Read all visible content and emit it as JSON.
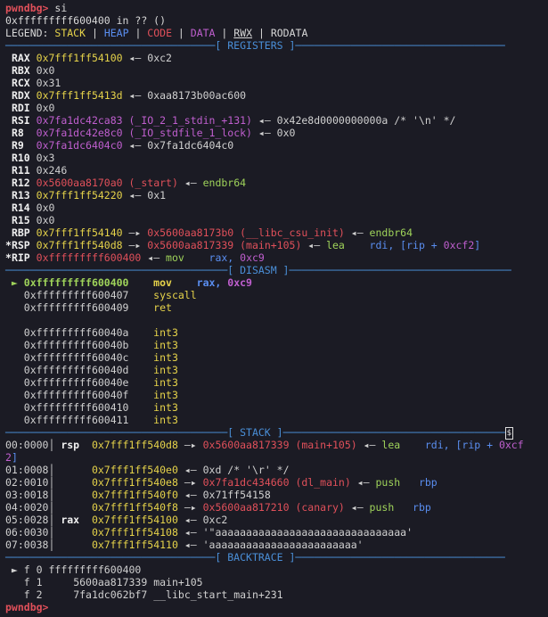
{
  "prompt": {
    "label": "pwndbg>",
    "command": "si"
  },
  "location": "0xfffffffff600400 in ?? ()",
  "legend": {
    "prefix": "LEGEND:",
    "items": [
      "STACK",
      "HEAP",
      "CODE",
      "DATA",
      "RWX",
      "RODATA"
    ],
    "sep": " | "
  },
  "headers": {
    "registers": "[ REGISTERS ]",
    "disasm": "[ DISASM ]",
    "stack": "[ STACK ]",
    "backtrace": "[ BACKTRACE ]"
  },
  "registers": [
    {
      "name": "RAX",
      "prefix": " ",
      "val": "0x7fff1ff54100",
      "val_color": "yel",
      "rest": [
        {
          "t": " ◂— ",
          "c": "gry"
        },
        {
          "t": "0xc2",
          "c": "gry"
        }
      ]
    },
    {
      "name": "RBX",
      "prefix": " ",
      "val": "0x0",
      "val_color": "gry",
      "rest": []
    },
    {
      "name": "RCX",
      "prefix": " ",
      "val": "0x31",
      "val_color": "gry",
      "rest": []
    },
    {
      "name": "RDX",
      "prefix": " ",
      "val": "0x7fff1ff5413d",
      "val_color": "yel",
      "rest": [
        {
          "t": " ◂— ",
          "c": "gry"
        },
        {
          "t": "0xaa8173b00ac600",
          "c": "gry"
        }
      ]
    },
    {
      "name": "RDI",
      "prefix": " ",
      "val": "0x0",
      "val_color": "gry",
      "rest": []
    },
    {
      "name": "RSI",
      "prefix": " ",
      "val": "0x7fa1dc42ca83 (_IO_2_1_stdin_+131)",
      "val_color": "mag",
      "rest": [
        {
          "t": " ◂— ",
          "c": "gry"
        },
        {
          "t": "0x42e8d0000000000a /* '\\n' */",
          "c": "gry"
        }
      ]
    },
    {
      "name": "R8",
      "prefix": " ",
      "val": "0x7fa1dc42e8c0 (_IO_stdfile_1_lock)",
      "val_color": "mag",
      "rest": [
        {
          "t": " ◂— ",
          "c": "gry"
        },
        {
          "t": "0x0",
          "c": "gry"
        }
      ]
    },
    {
      "name": "R9",
      "prefix": " ",
      "val": "0x7fa1dc6404c0",
      "val_color": "mag",
      "rest": [
        {
          "t": " ◂— ",
          "c": "gry"
        },
        {
          "t": "0x7fa1dc6404c0",
          "c": "gry"
        }
      ]
    },
    {
      "name": "R10",
      "prefix": " ",
      "val": "0x3",
      "val_color": "gry",
      "rest": []
    },
    {
      "name": "R11",
      "prefix": " ",
      "val": "0x246",
      "val_color": "gry",
      "rest": []
    },
    {
      "name": "R12",
      "prefix": " ",
      "val": "0x5600aa8170a0 (_start)",
      "val_color": "red",
      "rest": [
        {
          "t": " ◂— ",
          "c": "gry"
        },
        {
          "t": "endbr64",
          "c": "grn"
        }
      ]
    },
    {
      "name": "R13",
      "prefix": " ",
      "val": "0x7fff1ff54220",
      "val_color": "yel",
      "rest": [
        {
          "t": " ◂— ",
          "c": "gry"
        },
        {
          "t": "0x1",
          "c": "gry"
        }
      ]
    },
    {
      "name": "R14",
      "prefix": " ",
      "val": "0x0",
      "val_color": "gry",
      "rest": []
    },
    {
      "name": "R15",
      "prefix": " ",
      "val": "0x0",
      "val_color": "gry",
      "rest": []
    },
    {
      "name": "RBP",
      "prefix": " ",
      "val": "0x7fff1ff54140",
      "val_color": "yel",
      "rest": [
        {
          "t": " —▸ ",
          "c": "gry"
        },
        {
          "t": "0x5600aa8173b0 (__libc_csu_init)",
          "c": "red"
        },
        {
          "t": " ◂— ",
          "c": "gry"
        },
        {
          "t": "endbr64",
          "c": "grn"
        }
      ]
    },
    {
      "name": "RSP",
      "prefix": "*",
      "val": "0x7fff1ff540d8",
      "val_color": "yel",
      "rest": [
        {
          "t": " —▸ ",
          "c": "gry"
        },
        {
          "t": "0x5600aa817339 (main+105)",
          "c": "red"
        },
        {
          "t": " ◂— ",
          "c": "gry"
        },
        {
          "t": "lea",
          "c": "grn"
        },
        {
          "t": "    rdi, [rip + ",
          "c": "blu"
        },
        {
          "t": "0xcf2",
          "c": "mag"
        },
        {
          "t": "]",
          "c": "blu"
        }
      ]
    },
    {
      "name": "RIP",
      "prefix": "*",
      "val": "0xfffffffff600400",
      "val_color": "red",
      "rest": [
        {
          "t": " ◂— ",
          "c": "gry"
        },
        {
          "t": "mov",
          "c": "grn"
        },
        {
          "t": "    rax, ",
          "c": "blu"
        },
        {
          "t": "0xc9",
          "c": "mag"
        }
      ]
    }
  ],
  "disasm": [
    {
      "cur": true,
      "addr": "0xfffffffff600400",
      "op": "mov",
      "args": [
        {
          "t": "rax, ",
          "c": "blu"
        },
        {
          "t": "0xc9",
          "c": "mag"
        }
      ]
    },
    {
      "cur": false,
      "addr": "0xfffffffff600407",
      "op": "syscall",
      "args": []
    },
    {
      "cur": false,
      "addr": "0xfffffffff600409",
      "op": "ret",
      "args": []
    },
    {
      "blank": true
    },
    {
      "cur": false,
      "addr": "0xfffffffff60040a",
      "op": "int3",
      "args": []
    },
    {
      "cur": false,
      "addr": "0xfffffffff60040b",
      "op": "int3",
      "args": []
    },
    {
      "cur": false,
      "addr": "0xfffffffff60040c",
      "op": "int3",
      "args": []
    },
    {
      "cur": false,
      "addr": "0xfffffffff60040d",
      "op": "int3",
      "args": []
    },
    {
      "cur": false,
      "addr": "0xfffffffff60040e",
      "op": "int3",
      "args": []
    },
    {
      "cur": false,
      "addr": "0xfffffffff60040f",
      "op": "int3",
      "args": []
    },
    {
      "cur": false,
      "addr": "0xfffffffff600410",
      "op": "int3",
      "args": []
    },
    {
      "cur": false,
      "addr": "0xfffffffff600411",
      "op": "int3",
      "args": []
    }
  ],
  "stack": [
    {
      "idx": "00:0000",
      "reg": "rsp",
      "addr": "0x7fff1ff540d8",
      "rest": [
        {
          "t": " —▸ ",
          "c": "gry"
        },
        {
          "t": "0x5600aa817339 (main+105)",
          "c": "red"
        },
        {
          "t": " ◂— ",
          "c": "gry"
        },
        {
          "t": "lea",
          "c": "grn"
        },
        {
          "t": "    rdi, [rip + ",
          "c": "blu"
        },
        {
          "t": "0xcf",
          "c": "mag"
        }
      ],
      "wrap": [
        {
          "t": "2",
          "c": "mag"
        },
        {
          "t": "]",
          "c": "blu"
        }
      ]
    },
    {
      "idx": "01:0008",
      "reg": "",
      "addr": "0x7fff1ff540e0",
      "rest": [
        {
          "t": " ◂— ",
          "c": "gry"
        },
        {
          "t": "0xd /* '\\r' */",
          "c": "gry"
        }
      ]
    },
    {
      "idx": "02:0010",
      "reg": "",
      "addr": "0x7fff1ff540e8",
      "rest": [
        {
          "t": " —▸ ",
          "c": "gry"
        },
        {
          "t": "0x7fa1dc434660 (dl_main)",
          "c": "red"
        },
        {
          "t": " ◂— ",
          "c": "gry"
        },
        {
          "t": "push",
          "c": "grn"
        },
        {
          "t": "   rbp",
          "c": "blu"
        }
      ]
    },
    {
      "idx": "03:0018",
      "reg": "",
      "addr": "0x7fff1ff540f0",
      "rest": [
        {
          "t": " ◂— ",
          "c": "gry"
        },
        {
          "t": "0x71ff54158",
          "c": "gry"
        }
      ]
    },
    {
      "idx": "04:0020",
      "reg": "",
      "addr": "0x7fff1ff540f8",
      "rest": [
        {
          "t": " —▸ ",
          "c": "gry"
        },
        {
          "t": "0x5600aa817210 (canary)",
          "c": "red"
        },
        {
          "t": " ◂— ",
          "c": "gry"
        },
        {
          "t": "push",
          "c": "grn"
        },
        {
          "t": "   rbp",
          "c": "blu"
        }
      ]
    },
    {
      "idx": "05:0028",
      "reg": "rax",
      "addr": "0x7fff1ff54100",
      "rest": [
        {
          "t": " ◂— ",
          "c": "gry"
        },
        {
          "t": "0xc2",
          "c": "gry"
        }
      ]
    },
    {
      "idx": "06:0030",
      "reg": "",
      "addr": "0x7fff1ff54108",
      "rest": [
        {
          "t": " ◂— ",
          "c": "gry"
        },
        {
          "t": "'\"aaaaaaaaaaaaaaaaaaaaaaaaaaaaaaa'",
          "c": "gry"
        }
      ]
    },
    {
      "idx": "07:0038",
      "reg": "",
      "addr": "0x7fff1ff54110",
      "rest": [
        {
          "t": " ◂— ",
          "c": "gry"
        },
        {
          "t": "'aaaaaaaaaaaaaaaaaaaaaaaa'",
          "c": "gry"
        }
      ]
    }
  ],
  "backtrace": [
    {
      "cur": true,
      "frame": "f 0",
      "addr": "fffffffff600400",
      "sym": ""
    },
    {
      "cur": false,
      "frame": "f 1",
      "addr": "5600aa817339",
      "sym": "main+105"
    },
    {
      "cur": false,
      "frame": "f 2",
      "addr": "7fa1dc062bf7",
      "sym": "__libc_start_main+231"
    }
  ],
  "bottom_prompt": "pwndbg>",
  "colors": {
    "background": "#1b1b24",
    "header": "#4a8fd8",
    "stack": "#e6d34a",
    "heap": "#5a8ef0",
    "code": "#e0505a",
    "data": "#c05fcf"
  }
}
